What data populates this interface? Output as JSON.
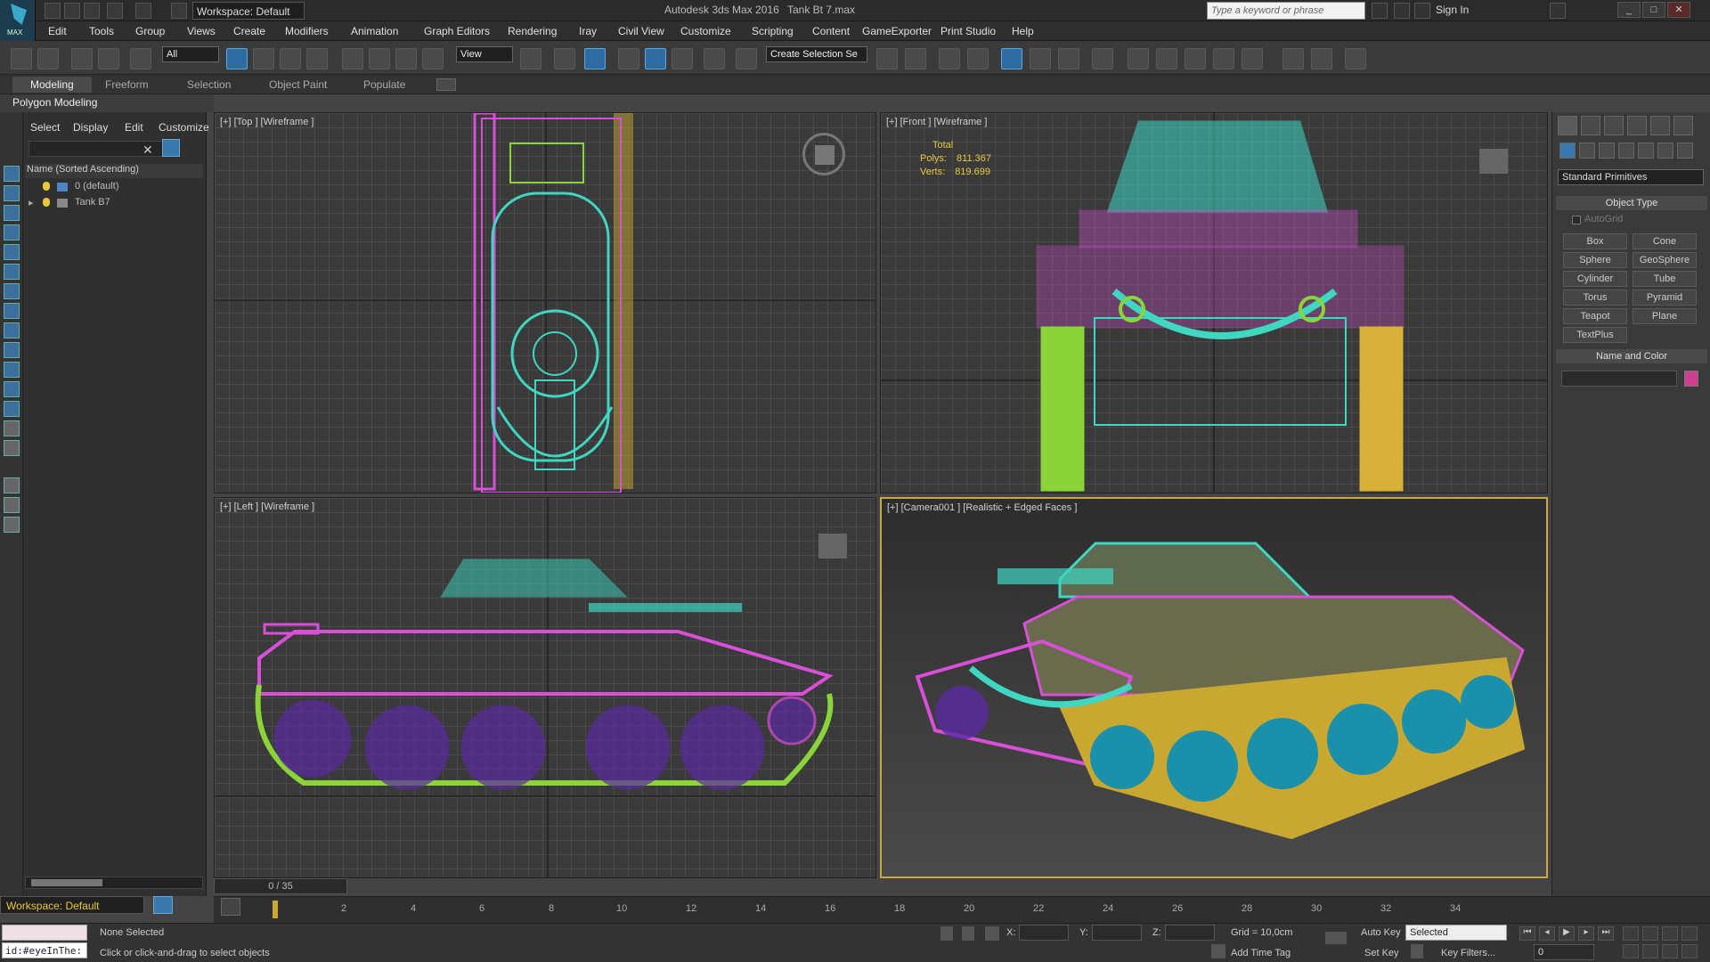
{
  "title_bar": {
    "app_logo_text": "MAX",
    "workspace_label": "Workspace: Default",
    "app_title": "Autodesk 3ds Max 2016",
    "file_title": "Tank Bt 7.max",
    "search_placeholder": "Type a keyword or phrase",
    "sign_in": "Sign In"
  },
  "menu": [
    "Edit",
    "Tools",
    "Group",
    "Views",
    "Create",
    "Modifiers",
    "Animation",
    "Graph Editors",
    "Rendering",
    "Iray",
    "Civil View",
    "Customize",
    "Scripting",
    "Content",
    "GameExporter",
    "Print Studio",
    "Help"
  ],
  "toolbar": {
    "selection_filter": "All",
    "ref_coord": "View",
    "named_selection": "Create Selection Se"
  },
  "ribbon": {
    "tabs": [
      "Modeling",
      "Freeform",
      "Selection",
      "Object Paint",
      "Populate"
    ],
    "active_tab": "Modeling",
    "panel_label": "Polygon Modeling"
  },
  "scene_explorer": {
    "tabs": [
      "Select",
      "Display",
      "Edit",
      "Customize"
    ],
    "column_header": "Name (Sorted Ascending)",
    "rows": [
      {
        "name": "0 (default)"
      },
      {
        "name": "Tank B7"
      }
    ],
    "workspace_footer": "Workspace: Default"
  },
  "viewports": {
    "top": {
      "label": "[+] [Top ] [Wireframe ]"
    },
    "front": {
      "label": "[+] [Front ] [Wireframe ]",
      "stats": {
        "total_label": "Total",
        "polys_label": "Polys:",
        "polys_value": "811.367",
        "verts_label": "Verts:",
        "verts_value": "819.699"
      }
    },
    "left": {
      "label": "[+] [Left ] [Wireframe ]"
    },
    "camera": {
      "label": "[+] [Camera001 ] [Realistic + Edged Faces ]"
    }
  },
  "command_panel": {
    "category_dropdown": "Standard Primitives",
    "object_type_title": "Object Type",
    "autogrid_label": "AutoGrid",
    "buttons": [
      "Box",
      "Cone",
      "Sphere",
      "GeoSphere",
      "Cylinder",
      "Tube",
      "Torus",
      "Pyramid",
      "Teapot",
      "Plane",
      "TextPlus"
    ],
    "name_color_title": "Name and Color",
    "object_color": "#d03f8e"
  },
  "timeline": {
    "frame_counter": "0 / 35",
    "ticks": [
      "2",
      "4",
      "6",
      "8",
      "10",
      "12",
      "14",
      "16",
      "18",
      "20",
      "22",
      "24",
      "26",
      "28",
      "30",
      "32",
      "34"
    ]
  },
  "status_bar": {
    "maxscript_text": "id:#eyeInThe:",
    "selection_status": "None Selected",
    "prompt": "Click or click-and-drag to select objects",
    "x_label": "X:",
    "y_label": "Y:",
    "z_label": "Z:",
    "grid": "Grid = 10,0cm",
    "auto_key": "Auto Key",
    "auto_key_mode": "Selected",
    "set_key": "Set Key",
    "key_filters": "Key Filters...",
    "add_time_tag": "Add Time Tag",
    "current_frame": "0"
  },
  "colors": {
    "wire_cyan": "#3fd6c2",
    "wire_magenta": "#d84fd8",
    "wire_green": "#8ad43a",
    "wire_yellow": "#d8b03a",
    "wire_purple": "#5a2aa0",
    "cam_border": "#c8a840",
    "stats_yellow": "#e8c83a"
  }
}
